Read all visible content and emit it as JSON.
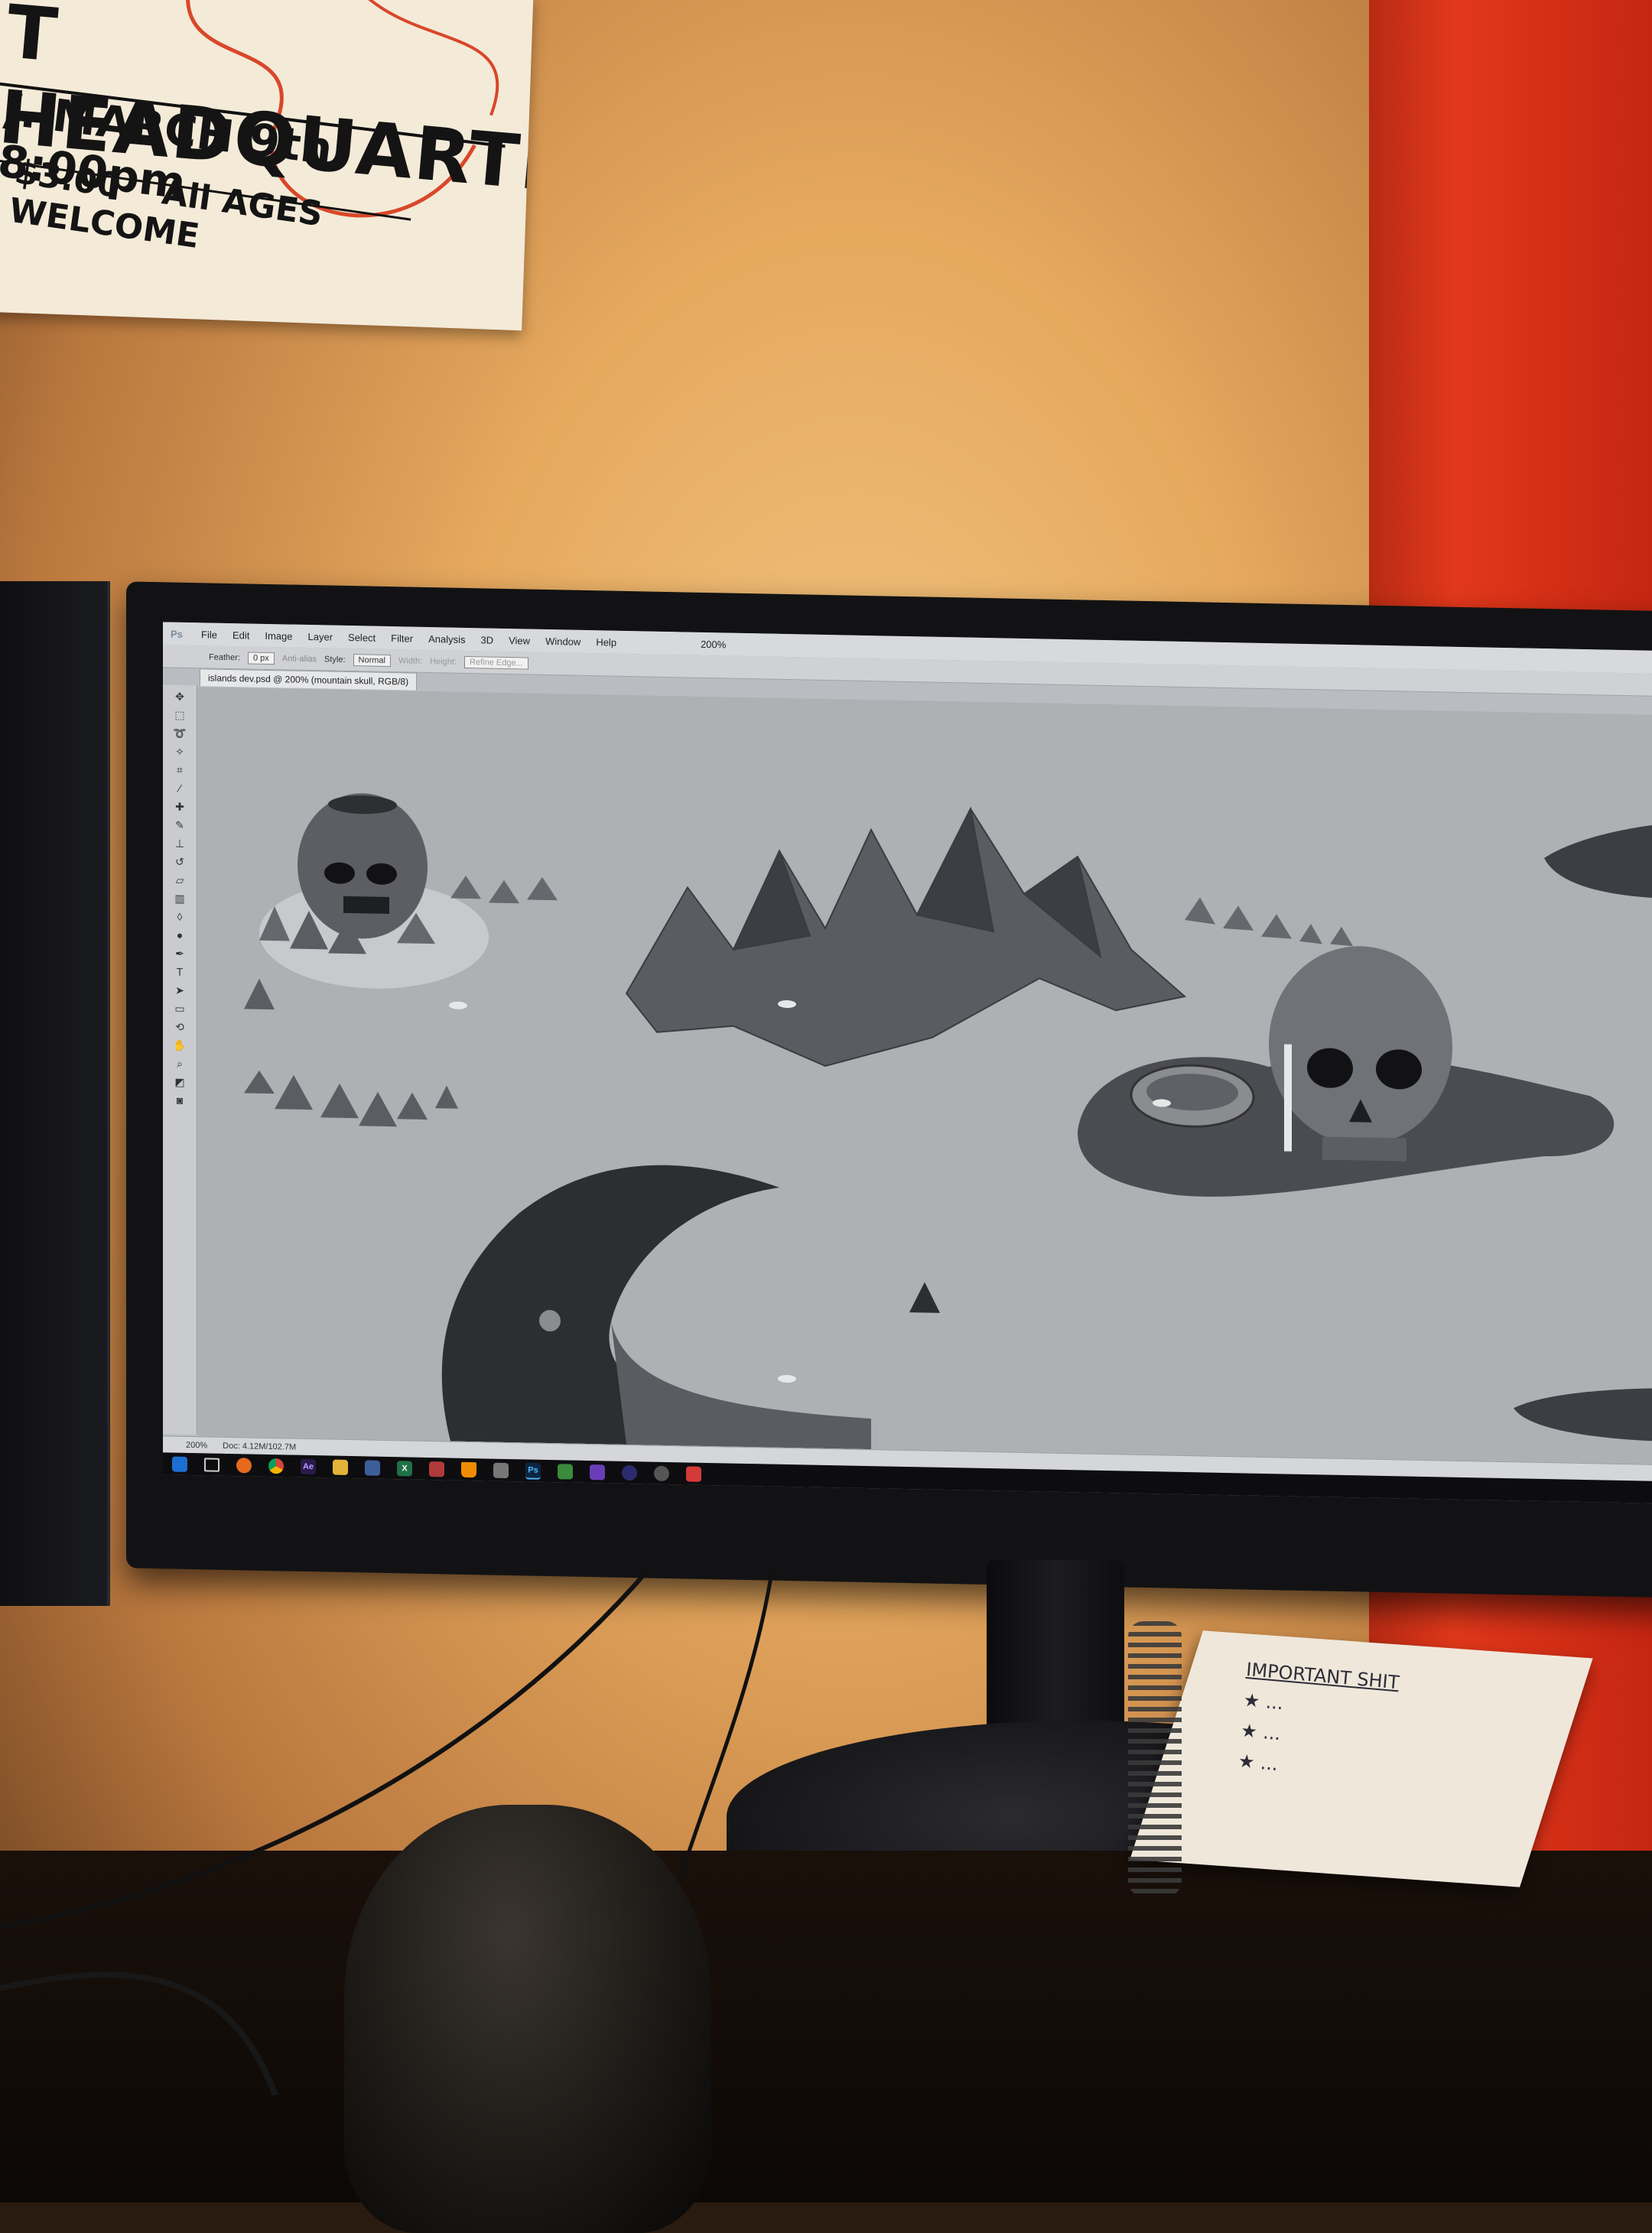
{
  "poster": {
    "line1": "T HEADQUARTERS",
    "line2": "/. MARCH 9th 8:00pm",
    "price": "$3.00",
    "line3_text": "All AGES WELCOME"
  },
  "app": {
    "logo": "Ps",
    "menu": [
      "File",
      "Edit",
      "Image",
      "Layer",
      "Select",
      "Filter",
      "Analysis",
      "3D",
      "View",
      "Window",
      "Help"
    ],
    "zoom_menu_value": "200%",
    "options": {
      "feather_label": "Feather:",
      "feather_value": "0 px",
      "antialias_label": "Anti-alias",
      "style_label": "Style:",
      "style_value": "Normal",
      "width_label": "Width:",
      "height_label": "Height:",
      "refine_label": "Refine Edge..."
    },
    "document_tab": "islands dev.psd @ 200% (mountain skull, RGB/8)",
    "status": {
      "zoom": "200%",
      "doc": "Doc: 4.12M/102.7M"
    }
  },
  "taskbar": {
    "icons": [
      "windows-icon",
      "taskview-icon",
      "firefox-icon",
      "chrome-icon",
      "after-effects-icon",
      "folder-icon",
      "app-icon",
      "excel-icon",
      "app-icon",
      "vlc-icon",
      "app-icon",
      "photoshop-icon",
      "app-icon",
      "visual-studio-icon",
      "app-icon",
      "app-icon",
      "app-icon"
    ],
    "labels": [
      "",
      "",
      "",
      "",
      "Ae",
      "",
      "",
      "X",
      "",
      "",
      "",
      "Ps",
      "",
      "",
      "",
      "",
      ""
    ]
  },
  "notebook": {
    "title": "IMPORTANT SHIT",
    "items": [
      "★ ...",
      "★ ...",
      "★ ..."
    ]
  },
  "colors": {
    "wall": "#eab46c",
    "red_wall": "#d9341a",
    "canvas_bg": "#aeb0b3",
    "terrain_light": "#6f7277",
    "terrain_dark": "#3c3e43",
    "terrain_darkest": "#2a2b2f"
  }
}
